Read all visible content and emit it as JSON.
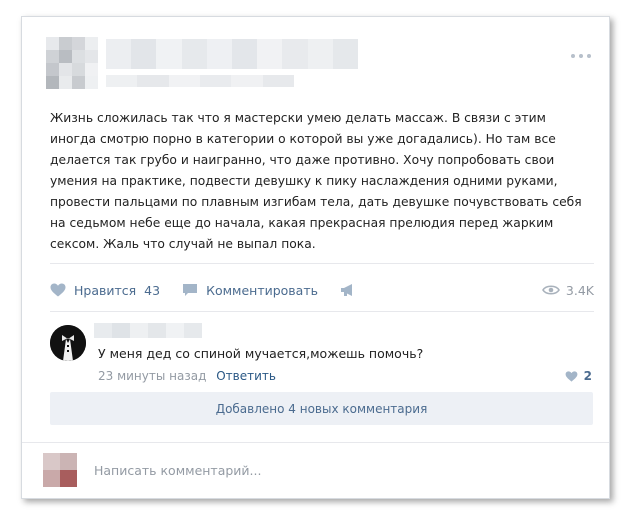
{
  "post": {
    "text_lines": [
      "Жизнь сложилась так что я мастерски умею делать массаж. В связи с этим",
      "иногда смотрю порно в категории о которой вы уже догадались). Но там все",
      "делается так грубо и наигранно, что даже противно. Хочу попробовать свои",
      "умения на практике, подвести девушку к пику наслаждения одними руками,",
      "провести пальцами по плавным изгибам тела, дать девушке почувствовать себя",
      "на седьмом небе еще до начала, какая прекрасная прелюдия перед жарким",
      "сексом. Жаль что случай не выпал пока."
    ]
  },
  "actions": {
    "like_label": "Нравится",
    "like_count": "43",
    "comment_label": "Комментировать",
    "views": "3.4K"
  },
  "comment": {
    "text": "У меня дед со спиной мучается,можешь помочь?",
    "time": "23 минуты назад",
    "reply_label": "Ответить",
    "likes": "2"
  },
  "more_comments_label": "Добавлено 4 новых комментария",
  "composer": {
    "placeholder": "Написать комментарий..."
  },
  "colors": {
    "link": "#2a5885",
    "action": "#4b6b8f",
    "muted": "#939aa3"
  }
}
